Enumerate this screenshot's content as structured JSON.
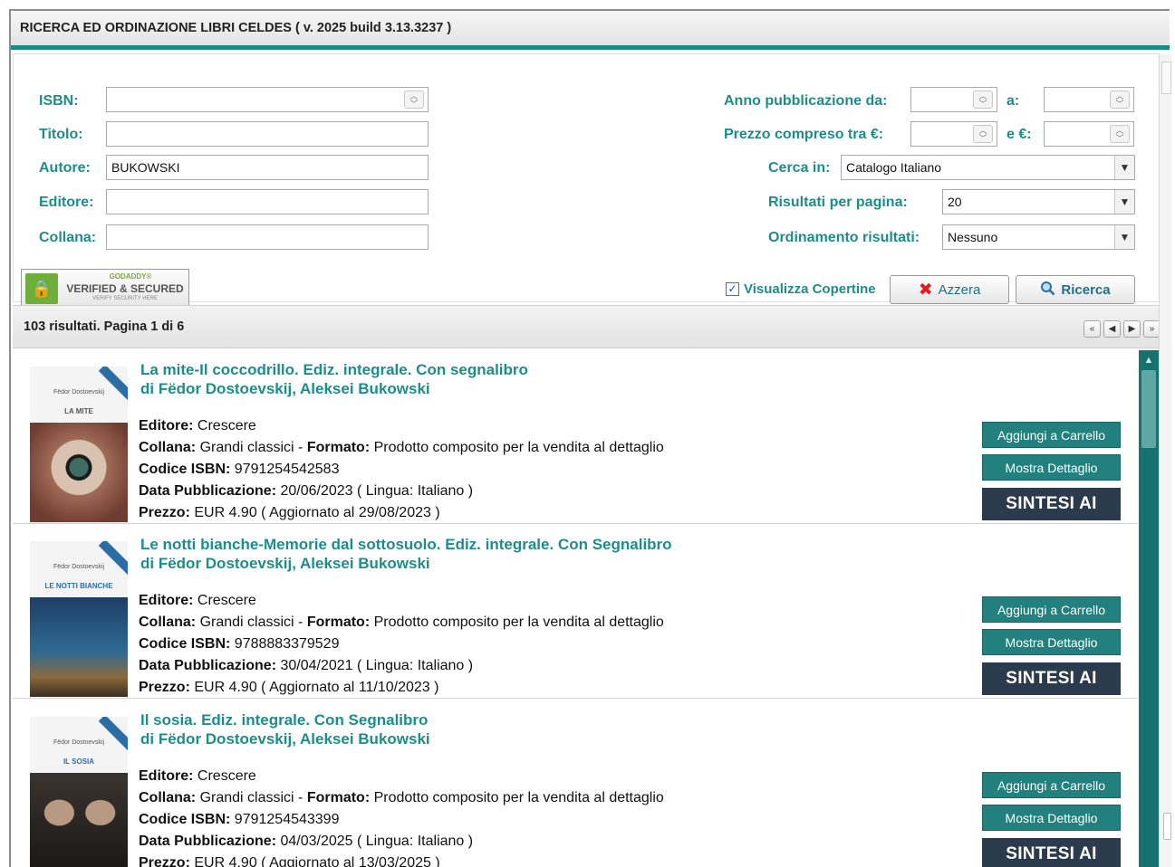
{
  "window": {
    "title": "RICERCA ED ORDINAZIONE LIBRI CELDES ( v. 2025 build 3.13.3237 )"
  },
  "form": {
    "isbn": {
      "label": "ISBN:",
      "value": ""
    },
    "titolo": {
      "label": "Titolo:",
      "value": ""
    },
    "autore": {
      "label": "Autore:",
      "value": "BUKOWSKI"
    },
    "editore": {
      "label": "Editore:",
      "value": ""
    },
    "collana": {
      "label": "Collana:",
      "value": ""
    },
    "anno_da": {
      "label": "Anno pubblicazione da:",
      "value": ""
    },
    "anno_a": {
      "label": "a:",
      "value": ""
    },
    "prezzo_da": {
      "label": "Prezzo compreso tra €:",
      "value": ""
    },
    "prezzo_a": {
      "label": "e €:",
      "value": ""
    },
    "cerca_in": {
      "label": "Cerca in:",
      "value": "Catalogo Italiano"
    },
    "risultati": {
      "label": "Risultati per pagina:",
      "value": "20"
    },
    "ordinamento": {
      "label": "Ordinamento risultati:",
      "value": "Nessuno"
    }
  },
  "badge": {
    "brand": "GODADDY®",
    "main": "VERIFIED & SECURED",
    "sub": "VERIFY SECURITY HERE"
  },
  "actions": {
    "covers_label": "Visualizza Copertine",
    "covers_checked": true,
    "reset_label": "Azzera",
    "search_label": "Ricerca"
  },
  "results": {
    "summary": "103 risultati. Pagina 1 di 6"
  },
  "labels": {
    "editore": "Editore:",
    "collana": "Collana:",
    "formato": "Formato:",
    "isbn": "Codice ISBN:",
    "data": "Data Pubblicazione:",
    "prezzo": "Prezzo:",
    "lingua_open": " ( Lingua: ",
    "lingua_close": " )",
    "agg_open": " ( Aggiornato al ",
    "agg_close": " )",
    "sep": " - "
  },
  "buttons": {
    "cart": "Aggiungi a Carrello",
    "detail": "Mostra Dettaglio",
    "ai": "SINTESI AI"
  },
  "books": [
    {
      "title": "La mite-Il coccodrillo. Ediz. integrale. Con segnalibro",
      "byline": "di Fëdor Dostoevskij, Aleksei Bukowski",
      "editore": "Crescere",
      "collana": "Grandi classici",
      "formato": "Prodotto composito per la vendita al dettaglio",
      "isbn": "9791254542583",
      "data": "20/06/2023",
      "lingua": "Italiano",
      "prezzo": "EUR 4.90",
      "aggiornato": "29/08/2023",
      "cover": {
        "author": "Fëdor Dostoevskij",
        "title": "LA MITE",
        "color": "#8f7a70"
      }
    },
    {
      "title": "Le notti bianche-Memorie dal sottosuolo. Ediz. integrale. Con Segnalibro",
      "byline": "di Fëdor Dostoevskij, Aleksei Bukowski",
      "editore": "Crescere",
      "collana": "Grandi classici",
      "formato": "Prodotto composito per la vendita al dettaglio",
      "isbn": "9788883379529",
      "data": "30/04/2021",
      "lingua": "Italiano",
      "prezzo": "EUR 4.90",
      "aggiornato": "11/10/2023",
      "cover": {
        "author": "Fëdor Dostoevskij",
        "title": "LE NOTTI BIANCHE",
        "color": "#1d3e66"
      }
    },
    {
      "title": "Il sosia. Ediz. integrale. Con Segnalibro",
      "byline": "di Fëdor Dostoevskij, Aleksei Bukowski",
      "editore": "Crescere",
      "collana": "Grandi classici",
      "formato": "Prodotto composito per la vendita al dettaglio",
      "isbn": "9791254543399",
      "data": "04/03/2025",
      "lingua": "Italiano",
      "prezzo": "EUR 4.90",
      "aggiornato": "13/03/2025",
      "cover": {
        "author": "Fëdor Dostoevskij",
        "title": "IL SOSIA",
        "color": "#3a3430"
      }
    }
  ],
  "colors": {
    "accent": "#1d8d8a",
    "action_button": "#22807e",
    "ai_button": "#2c3a4d",
    "scrollbar": "#15726f"
  },
  "icons": {
    "reset": "red-x-icon",
    "search": "magnifier-icon",
    "lock": "padlock-icon"
  }
}
